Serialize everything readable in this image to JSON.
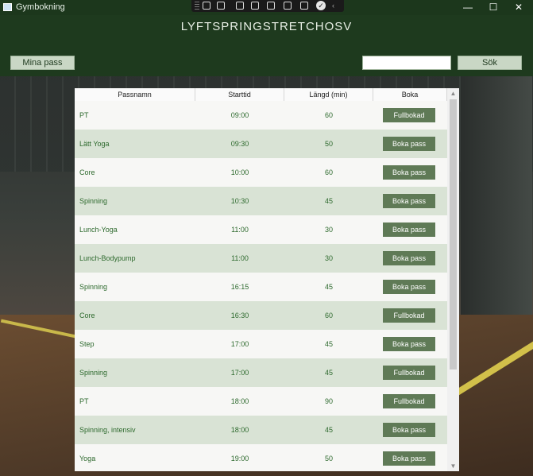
{
  "window": {
    "title": "Gymbokning",
    "minimize": "—",
    "maximize": "☐",
    "close": "✕"
  },
  "header": {
    "title": "LYFTSPRINGSTRETCHOSV",
    "my_sessions": "Mina pass",
    "search_value": "",
    "search_button": "Sök"
  },
  "table": {
    "columns": [
      "Passnamn",
      "Starttid",
      "Längd (min)",
      "Boka"
    ],
    "rows": [
      {
        "name": "PT",
        "time": "09:00",
        "length": "60",
        "action": "Fullbokad"
      },
      {
        "name": "Lätt Yoga",
        "time": "09:30",
        "length": "50",
        "action": "Boka pass"
      },
      {
        "name": "Core",
        "time": "10:00",
        "length": "60",
        "action": "Boka pass"
      },
      {
        "name": "Spinning",
        "time": "10:30",
        "length": "45",
        "action": "Boka pass"
      },
      {
        "name": "Lunch-Yoga",
        "time": "11:00",
        "length": "30",
        "action": "Boka pass"
      },
      {
        "name": "Lunch-Bodypump",
        "time": "11:00",
        "length": "30",
        "action": "Boka pass"
      },
      {
        "name": "Spinning",
        "time": "16:15",
        "length": "45",
        "action": "Boka pass"
      },
      {
        "name": "Core",
        "time": "16:30",
        "length": "60",
        "action": "Fullbokad"
      },
      {
        "name": "Step",
        "time": "17:00",
        "length": "45",
        "action": "Boka pass"
      },
      {
        "name": "Spinning",
        "time": "17:00",
        "length": "45",
        "action": "Fullbokad"
      },
      {
        "name": "PT",
        "time": "18:00",
        "length": "90",
        "action": "Fullbokad"
      },
      {
        "name": "Spinning, intensiv",
        "time": "18:00",
        "length": "45",
        "action": "Boka pass"
      },
      {
        "name": "Yoga",
        "time": "19:00",
        "length": "50",
        "action": "Boka pass"
      }
    ]
  },
  "colors": {
    "header_bg": "#1e3a1e",
    "button_green": "#5f7a56",
    "row_alt": "#d9e3d5",
    "text_green": "#2e6a2e"
  }
}
